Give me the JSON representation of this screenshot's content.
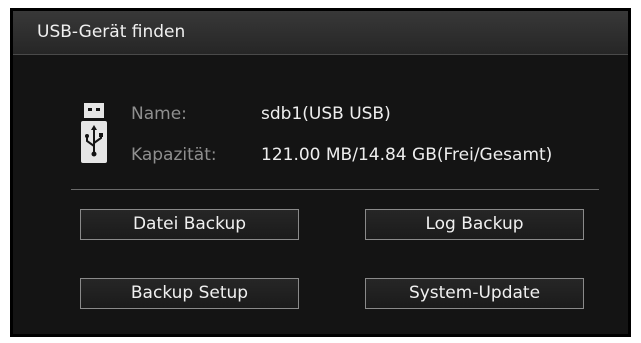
{
  "dialog": {
    "title": "USB-Gerät finden"
  },
  "device": {
    "icon": "usb-drive-icon",
    "name_label": "Name:",
    "name_value": "sdb1(USB USB)",
    "capacity_label": "Kapazität:",
    "capacity_value": "121.00 MB/14.84 GB(Frei/Gesamt)"
  },
  "buttons": {
    "file_backup": "Datei Backup",
    "log_backup": "Log Backup",
    "backup_setup": "Backup Setup",
    "system_update": "System-Update"
  },
  "colors": {
    "background": "#141414",
    "titlebar": "#2e2e2e",
    "label_text": "#8f8f8f",
    "value_text": "#eeeeee",
    "button_border": "#8a8a8a"
  }
}
